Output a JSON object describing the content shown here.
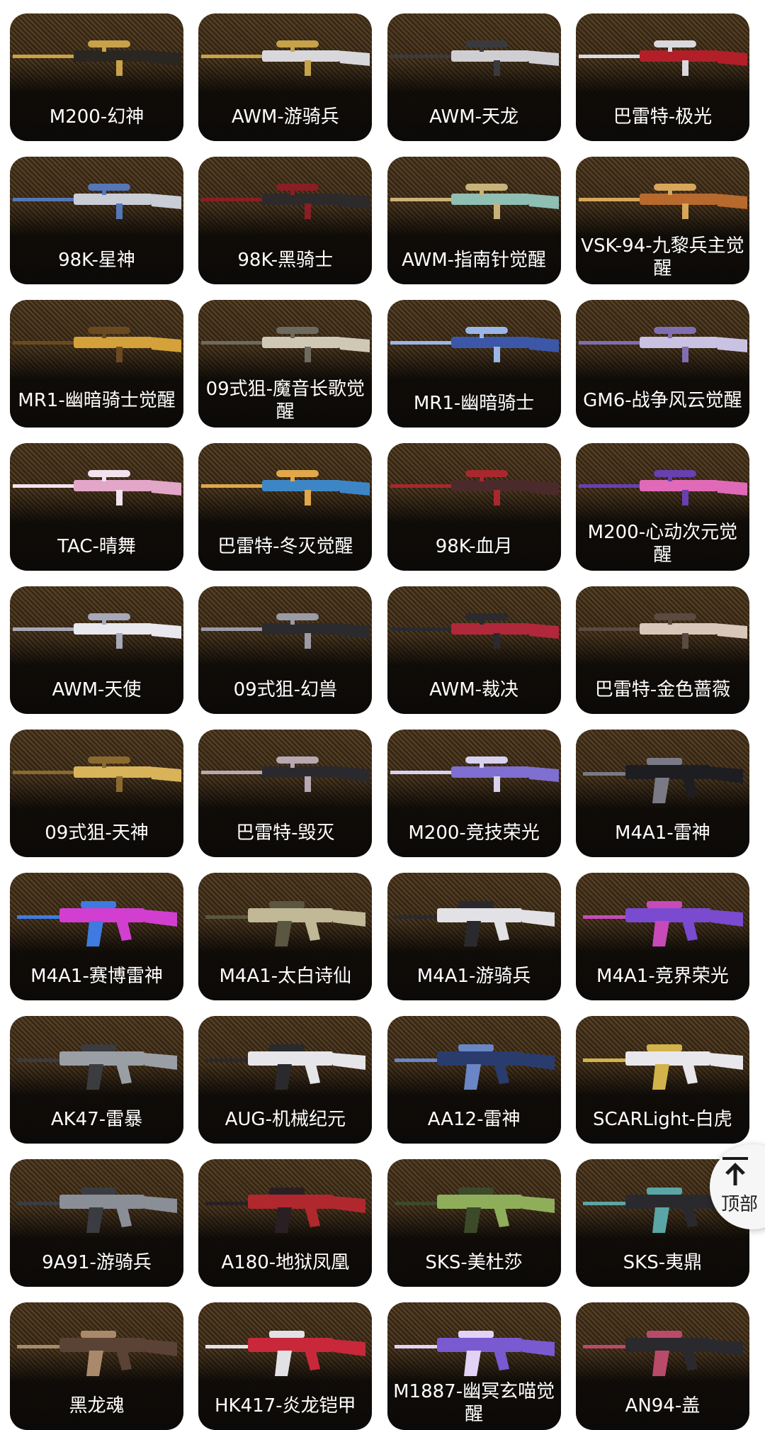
{
  "colors": {
    "card_bg": "#1a130d",
    "card_texture": "#5b4426",
    "label_text": "#ffffff",
    "back_to_top_bg": "#f6f6f6"
  },
  "weapons": [
    {
      "label": "M200-幻神",
      "palette": [
        "#2a2622",
        "#c9a14a"
      ]
    },
    {
      "label": "AWM-游骑兵",
      "palette": [
        "#d8d8dc",
        "#c6a24a"
      ]
    },
    {
      "label": "AWM-天龙",
      "palette": [
        "#cfcfd3",
        "#3a3a3e"
      ]
    },
    {
      "label": "巴雷特-极光",
      "palette": [
        "#b21f28",
        "#d9d9dd"
      ]
    },
    {
      "label": "98K-星神",
      "palette": [
        "#c9cdd6",
        "#5576b8"
      ]
    },
    {
      "label": "98K-黑骑士",
      "palette": [
        "#2c2a2a",
        "#8a1e24"
      ]
    },
    {
      "label": "AWM-指南针觉醒",
      "palette": [
        "#8fbfb3",
        "#c9b27a"
      ]
    },
    {
      "label": "VSK-94-九黎兵主觉醒",
      "palette": [
        "#b7692e",
        "#d8a65a"
      ]
    },
    {
      "label": "MR1-幽暗骑士觉醒",
      "palette": [
        "#d4a13a",
        "#6b4a20"
      ]
    },
    {
      "label": "09式狙-魔音长歌觉醒",
      "palette": [
        "#cfc8b4",
        "#6e6a5e"
      ]
    },
    {
      "label": "MR1-幽暗骑士",
      "palette": [
        "#3c57a8",
        "#9ab6e6"
      ]
    },
    {
      "label": "GM6-战争风云觉醒",
      "palette": [
        "#c9c2e2",
        "#7f6fb0"
      ]
    },
    {
      "label": "TAC-晴舞",
      "palette": [
        "#e2a6c8",
        "#f2e2ee"
      ]
    },
    {
      "label": "巴雷特-冬灭觉醒",
      "palette": [
        "#3d86c6",
        "#e0a84a"
      ]
    },
    {
      "label": "98K-血月",
      "palette": [
        "#4a2a2a",
        "#a8282e"
      ]
    },
    {
      "label": "M200-心动次元觉醒",
      "palette": [
        "#e06ab8",
        "#6a3fb0"
      ]
    },
    {
      "label": "AWM-天使",
      "palette": [
        "#e8e8ee",
        "#a7a8b8"
      ]
    },
    {
      "label": "09式狙-幻兽",
      "palette": [
        "#2b2b2e",
        "#9b9ba6"
      ]
    },
    {
      "label": "AWM-裁决",
      "palette": [
        "#b0283a",
        "#2a2a30"
      ]
    },
    {
      "label": "巴雷特-金色蔷薇",
      "palette": [
        "#d9c8ba",
        "#5a4a40"
      ]
    },
    {
      "label": "09式狙-天神",
      "palette": [
        "#d8b35a",
        "#8a6a2e"
      ]
    },
    {
      "label": "巴雷特-毁灭",
      "palette": [
        "#2a2a2e",
        "#b8a8b2"
      ]
    },
    {
      "label": "M200-竞技荣光",
      "palette": [
        "#7f6fd0",
        "#d8d2f0"
      ]
    },
    {
      "label": "M4A1-雷神",
      "palette": [
        "#1e1e22",
        "#7a7a86"
      ]
    },
    {
      "label": "M4A1-赛博雷神",
      "palette": [
        "#d23fd0",
        "#3f7ae0"
      ]
    },
    {
      "label": "M4A1-太白诗仙",
      "palette": [
        "#c0b896",
        "#5a5640"
      ]
    },
    {
      "label": "M4A1-游骑兵",
      "palette": [
        "#e2e2e6",
        "#2a2a2e"
      ]
    },
    {
      "label": "M4A1-竞界荣光",
      "palette": [
        "#7a4ad0",
        "#c84ab8"
      ]
    },
    {
      "label": "AK47-雷暴",
      "palette": [
        "#9a9fa6",
        "#3a3c40"
      ]
    },
    {
      "label": "AUG-机械纪元",
      "palette": [
        "#e6e6ea",
        "#2a2a2e"
      ]
    },
    {
      "label": "AA12-雷神",
      "palette": [
        "#2a3c6e",
        "#6a86c6"
      ]
    },
    {
      "label": "SCARLight-白虎",
      "palette": [
        "#e8e8ec",
        "#d2b24a"
      ]
    },
    {
      "label": "9A91-游骑兵",
      "palette": [
        "#8a8e96",
        "#3a3c42"
      ]
    },
    {
      "label": "A180-地狱凤凰",
      "palette": [
        "#b0282e",
        "#2a2024"
      ]
    },
    {
      "label": "SKS-美杜莎",
      "palette": [
        "#8fae5a",
        "#3c4a2a"
      ]
    },
    {
      "label": "SKS-夷鼎",
      "palette": [
        "#2a2a2e",
        "#5aa6a6"
      ]
    },
    {
      "label": "黑龙魂",
      "palette": [
        "#5a4234",
        "#a88a6a"
      ]
    },
    {
      "label": "HK417-炎龙铠甲",
      "palette": [
        "#c8283a",
        "#e2e2e6"
      ]
    },
    {
      "label": "M1887-幽冥玄喵觉醒",
      "palette": [
        "#7a5ad0",
        "#e2d2f6"
      ]
    },
    {
      "label": "AN94-盖",
      "palette": [
        "#2a2a2e",
        "#b84a6a"
      ]
    }
  ],
  "back_to_top": {
    "label": "顶部",
    "icon": "arrow-up-to-top-icon"
  }
}
